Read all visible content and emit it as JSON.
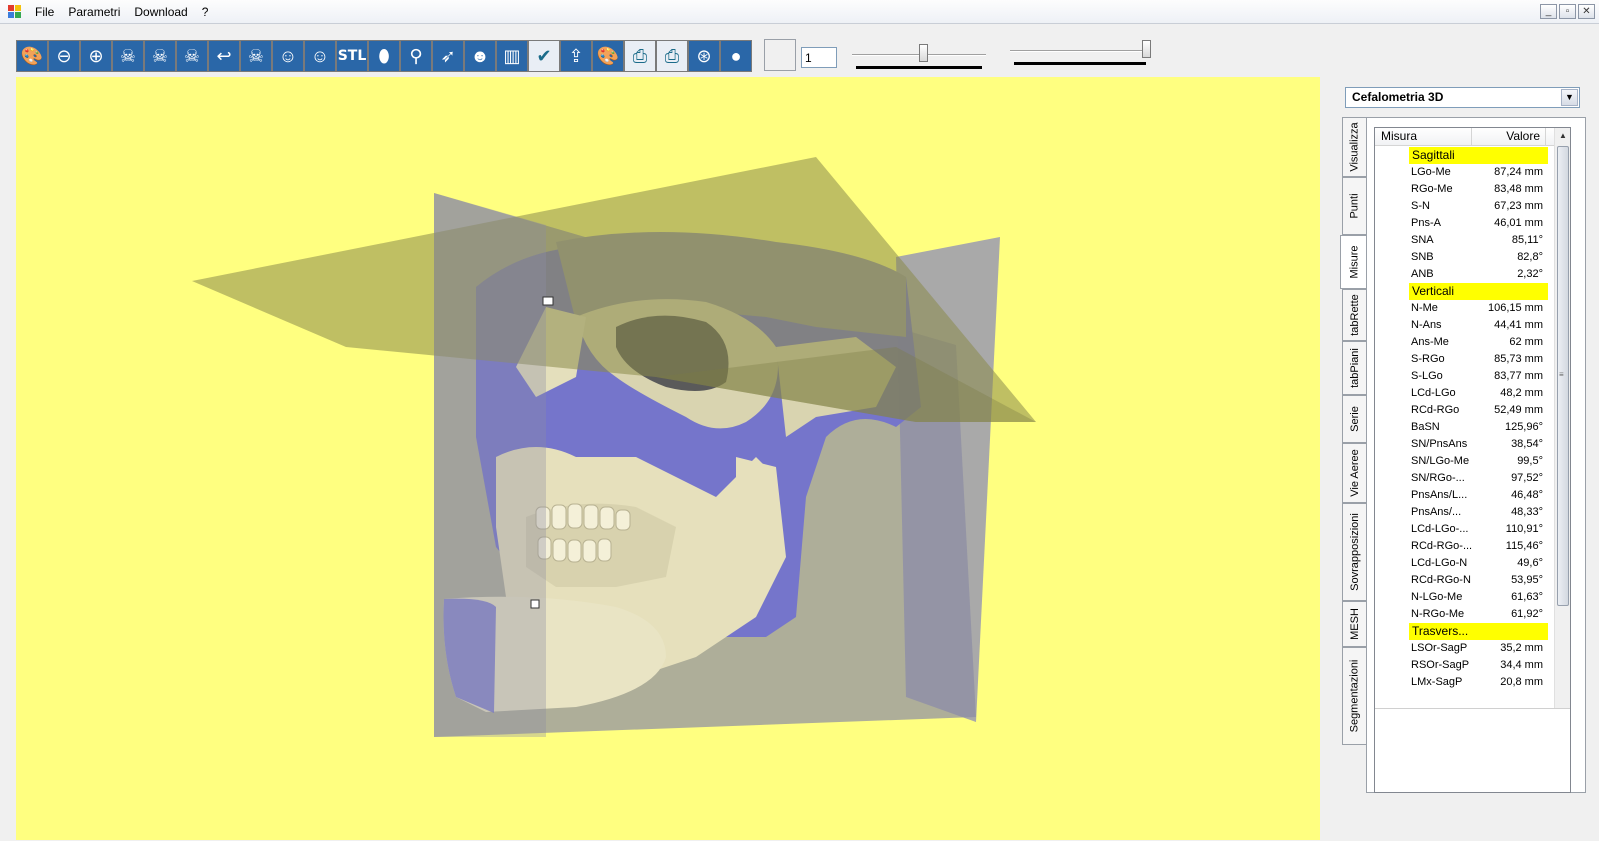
{
  "menu": {
    "items": [
      "File",
      "Parametri",
      "Download",
      "?"
    ]
  },
  "window_buttons": {
    "minimize": "_",
    "restore": "▫",
    "close": "✕"
  },
  "toolbar": {
    "buttons": [
      {
        "name": "palette-icon",
        "glyph": "🎨"
      },
      {
        "name": "zoom-out-icon",
        "glyph": "⊖"
      },
      {
        "name": "zoom-in-icon",
        "glyph": "⊕"
      },
      {
        "name": "skull-rotate-left-icon",
        "glyph": "☠"
      },
      {
        "name": "skull-rotate-icon",
        "glyph": "☠"
      },
      {
        "name": "skull-rotate-right-icon",
        "glyph": "☠"
      },
      {
        "name": "undo-arrow-icon",
        "glyph": "↩"
      },
      {
        "name": "skull-icon",
        "glyph": "☠"
      },
      {
        "name": "face-icon",
        "glyph": "☺"
      },
      {
        "name": "face-profile-icon",
        "glyph": "☺"
      },
      {
        "name": "stl-icon",
        "glyph": "STL"
      },
      {
        "name": "shield-icon",
        "glyph": "⬮"
      },
      {
        "name": "point-marker-icon",
        "glyph": "⚲"
      },
      {
        "name": "pointer-tool-icon",
        "glyph": "➶"
      },
      {
        "name": "face-front-icon",
        "glyph": "☻"
      },
      {
        "name": "teeth-icon",
        "glyph": "▥"
      },
      {
        "name": "check-icon",
        "glyph": "✔"
      },
      {
        "name": "export-folder-icon",
        "glyph": "⇪"
      },
      {
        "name": "palette-2-icon",
        "glyph": "🎨"
      },
      {
        "name": "print-icon",
        "glyph": "⎙"
      },
      {
        "name": "print-preview-icon",
        "glyph": "⎙"
      },
      {
        "name": "target-icon",
        "glyph": "⊛"
      },
      {
        "name": "color-balls-icon",
        "glyph": "●"
      }
    ],
    "number_value": "1"
  },
  "colors": {
    "viewport_bg": "#ffff80",
    "section_highlight": "#ffff00"
  },
  "panel": {
    "selector_value": "Cefalometria 3D",
    "tabs": [
      "Visualizza",
      "Punti",
      "Misure",
      "tabRette",
      "tabPiani",
      "Serie",
      "Vie Aeree",
      "Sovrapposizioni",
      "MESH",
      "Segmentazioni"
    ],
    "active_tab": "Misure",
    "columns": {
      "misura": "Misura",
      "valore": "Valore"
    },
    "rows": [
      {
        "section": "Sagittali"
      },
      {
        "name": "LGo-Me",
        "value": "87,24 mm"
      },
      {
        "name": "RGo-Me",
        "value": "83,48 mm"
      },
      {
        "name": "S-N",
        "value": "67,23 mm"
      },
      {
        "name": "Pns-A",
        "value": "46,01 mm"
      },
      {
        "name": "SNA",
        "value": "85,11°"
      },
      {
        "name": "SNB",
        "value": "82,8°"
      },
      {
        "name": "ANB",
        "value": "2,32°"
      },
      {
        "section": "Verticali"
      },
      {
        "name": "N-Me",
        "value": "106,15 mm"
      },
      {
        "name": "N-Ans",
        "value": "44,41 mm"
      },
      {
        "name": "Ans-Me",
        "value": "62 mm"
      },
      {
        "name": "S-RGo",
        "value": "85,73 mm"
      },
      {
        "name": "S-LGo",
        "value": "83,77 mm"
      },
      {
        "name": "LCd-LGo",
        "value": "48,2 mm"
      },
      {
        "name": "RCd-RGo",
        "value": "52,49 mm"
      },
      {
        "name": "BaSN",
        "value": "125,96°"
      },
      {
        "name": "SN/PnsAns",
        "value": "38,54°"
      },
      {
        "name": "SN/LGo-Me",
        "value": "99,5°"
      },
      {
        "name": "SN/RGo-...",
        "value": "97,52°"
      },
      {
        "name": "PnsAns/L...",
        "value": "46,48°"
      },
      {
        "name": "PnsAns/...",
        "value": "48,33°"
      },
      {
        "name": "LCd-LGo-...",
        "value": "110,91°"
      },
      {
        "name": "RCd-RGo-...",
        "value": "115,46°"
      },
      {
        "name": "LCd-LGo-N",
        "value": "49,6°"
      },
      {
        "name": "RCd-RGo-N",
        "value": "53,95°"
      },
      {
        "name": "N-LGo-Me",
        "value": "61,63°"
      },
      {
        "name": "N-RGo-Me",
        "value": "61,92°"
      },
      {
        "section": "Trasvers..."
      },
      {
        "name": "LSOr-SagP",
        "value": "35,2 mm"
      },
      {
        "name": "RSOr-SagP",
        "value": "34,4 mm"
      },
      {
        "name": "LMx-SagP",
        "value": "20,8 mm"
      }
    ]
  }
}
